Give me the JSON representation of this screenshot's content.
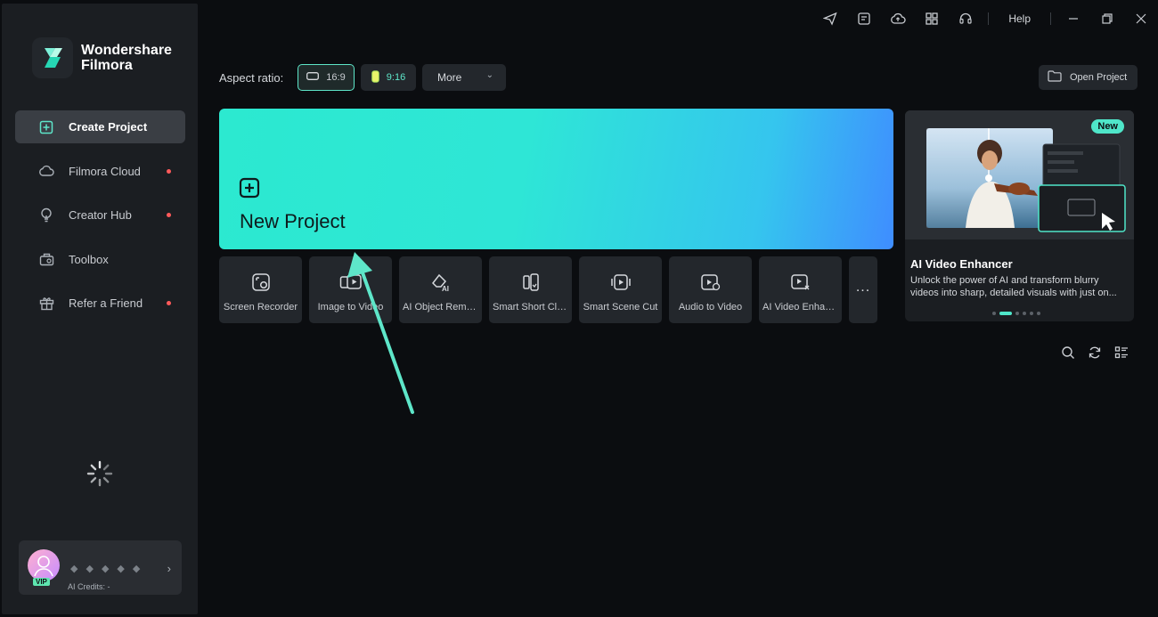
{
  "app": {
    "brand_line1": "Wondershare",
    "brand_line2": "Filmora"
  },
  "sidebar": {
    "items": [
      {
        "label": "Create Project",
        "icon": "plus-square-icon",
        "active": true,
        "dot": false
      },
      {
        "label": "Filmora Cloud",
        "icon": "cloud-icon",
        "active": false,
        "dot": true
      },
      {
        "label": "Creator Hub",
        "icon": "bulb-icon",
        "active": false,
        "dot": true
      },
      {
        "label": "Toolbox",
        "icon": "toolbox-icon",
        "active": false,
        "dot": false
      },
      {
        "label": "Refer a Friend",
        "icon": "gift-icon",
        "active": false,
        "dot": true
      }
    ]
  },
  "user": {
    "vip_label": "VIP",
    "credits_label": "AI Credits: -"
  },
  "titlebar": {
    "help_label": "Help"
  },
  "aspect": {
    "label": "Aspect ratio:",
    "options": [
      "16:9",
      "9:16"
    ],
    "more_label": "More"
  },
  "open_project_label": "Open Project",
  "new_project": {
    "title": "New Project"
  },
  "tools": [
    {
      "label": "Screen Recorder",
      "icon": "screen-recorder-icon"
    },
    {
      "label": "Image to Video",
      "icon": "image-to-video-icon"
    },
    {
      "label": "AI Object Remo...",
      "icon": "ai-object-remover-icon"
    },
    {
      "label": "Smart Short Clips",
      "icon": "smart-short-clips-icon"
    },
    {
      "label": "Smart Scene Cut",
      "icon": "smart-scene-cut-icon"
    },
    {
      "label": "Audio to Video",
      "icon": "audio-to-video-icon"
    },
    {
      "label": "AI Video Enhan...",
      "icon": "ai-video-enhancer-icon"
    }
  ],
  "more_tools_label": "...",
  "promo": {
    "badge": "New",
    "title": "AI Video Enhancer",
    "description": "Unlock the power of AI and transform blurry videos into sharp, detailed visuals with just on...",
    "page_count": 6,
    "current_page": 2
  },
  "colors": {
    "accent": "#4fe6c9",
    "new_project_gradient_start": "#2ce9d0",
    "new_project_gradient_end": "#3f8dff",
    "notification_dot": "#ff5a5a"
  }
}
